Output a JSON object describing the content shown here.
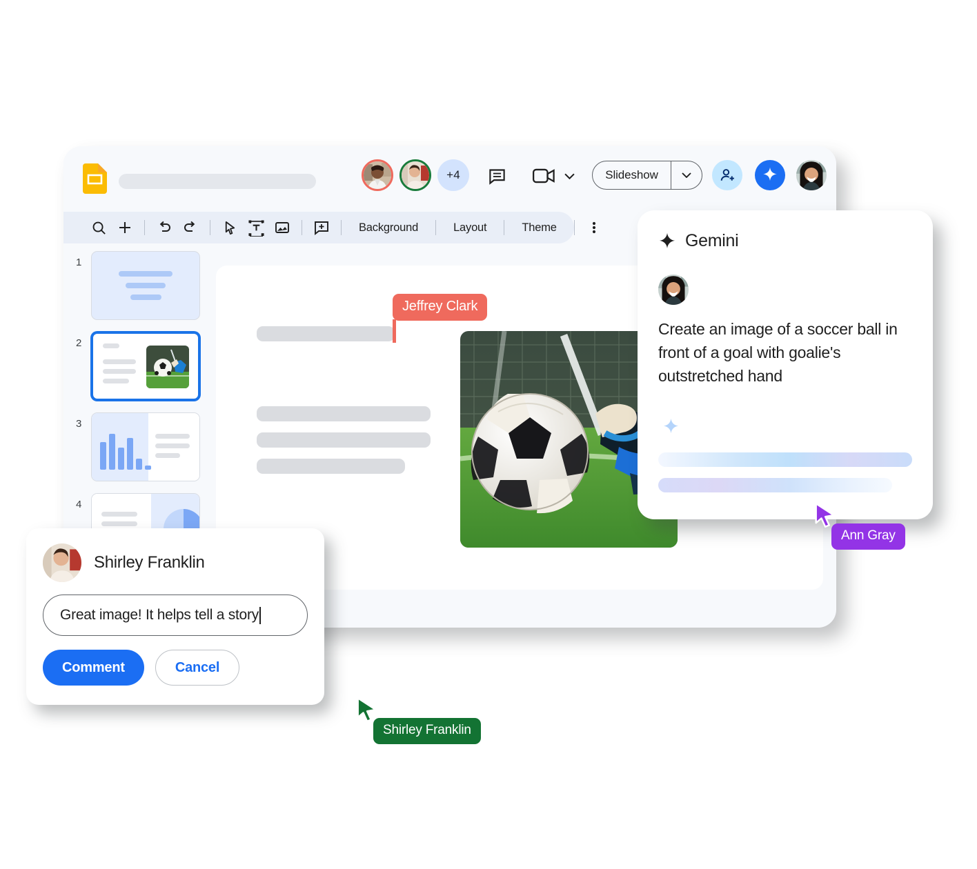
{
  "app": {
    "name": "Google Slides",
    "logo_icon": "slides-logo-icon",
    "document_title": ""
  },
  "topbar": {
    "collaborators": [
      {
        "name": "Jeffrey Clark",
        "ring_color": "#ef6a5d"
      },
      {
        "name": "Shirley Franklin",
        "ring_color": "#197b3b"
      }
    ],
    "overflow_count_label": "+4",
    "comment_icon": "comment-icon",
    "meet_icon": "video-camera-icon",
    "meet_caret_icon": "chevron-down-icon",
    "slideshow_label": "Slideshow",
    "slideshow_caret_icon": "chevron-down-icon",
    "share_icon": "person-add-icon",
    "gemini_icon": "gemini-sparkle-icon",
    "account_avatar": "user-avatar"
  },
  "toolbar": {
    "items": [
      {
        "kind": "icon",
        "name": "search-icon"
      },
      {
        "kind": "icon",
        "name": "add-slide-icon"
      },
      {
        "kind": "divider"
      },
      {
        "kind": "icon",
        "name": "undo-icon"
      },
      {
        "kind": "icon",
        "name": "redo-icon"
      },
      {
        "kind": "divider"
      },
      {
        "kind": "icon",
        "name": "select-cursor-icon"
      },
      {
        "kind": "icon",
        "name": "text-box-icon"
      },
      {
        "kind": "icon",
        "name": "insert-image-icon"
      },
      {
        "kind": "divider"
      },
      {
        "kind": "icon",
        "name": "insert-shape-icon"
      },
      {
        "kind": "divider"
      },
      {
        "kind": "text",
        "label": "Background"
      },
      {
        "kind": "divider"
      },
      {
        "kind": "text",
        "label": "Layout"
      },
      {
        "kind": "divider"
      },
      {
        "kind": "text",
        "label": "Theme"
      },
      {
        "kind": "divider"
      },
      {
        "kind": "icon",
        "name": "more-options-icon"
      }
    ],
    "labels": {
      "background": "Background",
      "layout": "Layout",
      "theme": "Theme"
    }
  },
  "slide_rail": {
    "slides": [
      {
        "number": "1",
        "layout": "title-slide",
        "selected": false
      },
      {
        "number": "2",
        "layout": "text-and-image",
        "selected": true
      },
      {
        "number": "3",
        "layout": "bar-chart-and-text",
        "selected": false
      },
      {
        "number": "4",
        "layout": "text-and-pie-chart",
        "selected": false
      }
    ]
  },
  "canvas": {
    "selected_slide": "2",
    "image_alt": "soccer ball in front of a goal with goalie's outstretched hand"
  },
  "cursors": [
    {
      "name": "Jeffrey Clark",
      "color": "#ef6a5d",
      "shape": "text-caret"
    },
    {
      "name": "Ann Gray",
      "color": "#9334e6",
      "shape": "arrow-pointer"
    },
    {
      "name": "Shirley Franklin",
      "color": "#137333",
      "shape": "arrow-pointer"
    }
  ],
  "gemini": {
    "title": "Gemini",
    "sparkle_icon": "gemini-sparkle-icon",
    "avatar": "user-avatar",
    "prompt": "Create an image of a soccer ball in front of a goal with goalie's outstretched hand",
    "loading_sparkle_icon": "sparkle-small-icon",
    "loading_bars": 2
  },
  "comment_popup": {
    "author": "Shirley Franklin",
    "avatar": "shirley-avatar",
    "input_value": "Great image! It helps tell a story",
    "input_placeholder": "Comment",
    "submit_label": "Comment",
    "cancel_label": "Cancel",
    "accent_color": "#1b6ef3"
  },
  "colors": {
    "window_bg": "#f7f9fc",
    "toolbar_bg": "#e9eef7",
    "selection_blue": "#1a73e8",
    "brand_blue": "#1b6ef3",
    "share_chip": "#c2e7ff",
    "slides_yellow": "#fbbc04"
  }
}
